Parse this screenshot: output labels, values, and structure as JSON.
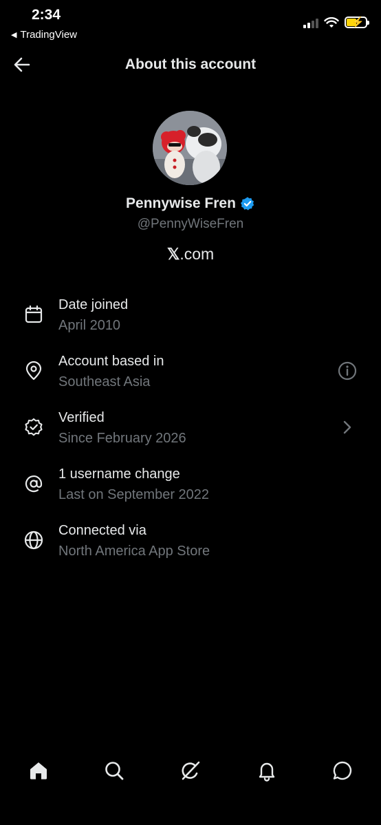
{
  "status_bar": {
    "time": "2:34",
    "back_app": "TradingView"
  },
  "header": {
    "title": "About this account"
  },
  "profile": {
    "name": "Pennywise Fren",
    "handle": "@PennyWiseFren",
    "platform_mark": "𝕏",
    "platform_suffix": ".com"
  },
  "info_items": [
    {
      "label": "Date joined",
      "value": "April 2010",
      "icon": "calendar-icon"
    },
    {
      "label": "Account based in",
      "value": "Southeast Asia",
      "icon": "location-pin-icon",
      "trailing_icon": "info-icon"
    },
    {
      "label": "Verified",
      "value": "Since February 2026",
      "icon": "verified-seal-icon",
      "trailing_icon": "chevron-right-icon"
    },
    {
      "label": "1 username change",
      "value": "Last on September 2022",
      "icon": "at-sign-icon"
    },
    {
      "label": "Connected via",
      "value": "North America App Store",
      "icon": "globe-icon"
    }
  ],
  "bottom_nav": [
    "home-icon",
    "search-icon",
    "grok-icon",
    "notifications-icon",
    "messages-icon"
  ],
  "colors": {
    "background": "#000000",
    "primary_text": "#e7e9ea",
    "secondary_text": "#71767b",
    "verified_blue": "#1d9bf0",
    "battery_yellow": "#ffd60a"
  }
}
